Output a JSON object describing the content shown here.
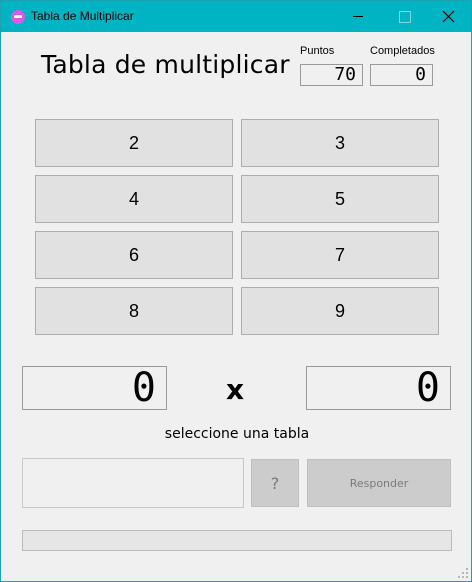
{
  "window": {
    "title": "Tabla de Multiplicar",
    "controls": {
      "minimize": "minimize",
      "maximize": "maximize",
      "close": "close"
    }
  },
  "header": {
    "title": "Tabla de multiplicar",
    "score": {
      "puntos_label": "Puntos",
      "puntos_value": "70",
      "completados_label": "Completados",
      "completados_value": "0"
    }
  },
  "tables": [
    "2",
    "3",
    "4",
    "5",
    "6",
    "7",
    "8",
    "9"
  ],
  "question": {
    "left": "0",
    "operator": "x",
    "right": "0"
  },
  "status_text": "seleccione una tabla",
  "answer": {
    "value": "",
    "placeholder": ""
  },
  "buttons": {
    "help": "?",
    "respond": "Responder"
  },
  "progress": {
    "fraction": 0
  },
  "colors": {
    "titlebar": "#00b4c4",
    "disabled_button": "#cccccc",
    "button_face": "#e1e1e1"
  }
}
